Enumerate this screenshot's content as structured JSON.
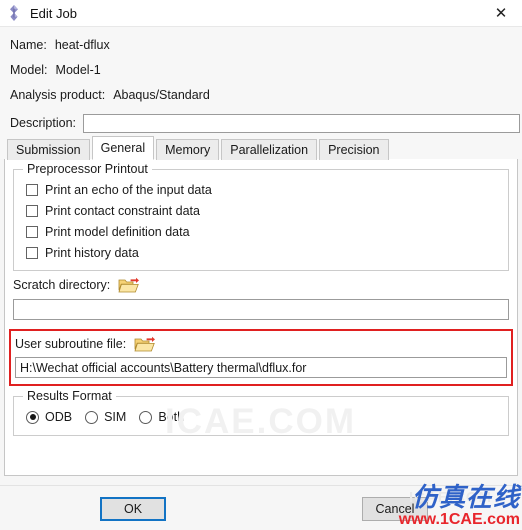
{
  "window": {
    "title": "Edit Job",
    "icon": "abaqus-diamond-icon",
    "close_label": "✕"
  },
  "header": {
    "name_label": "Name:",
    "name_value": "heat-dflux",
    "model_label": "Model:",
    "model_value": "Model-1",
    "analysis_label": "Analysis product:",
    "analysis_value": "Abaqus/Standard",
    "description_label": "Description:",
    "description_value": "",
    "description_placeholder": ""
  },
  "tabs": [
    {
      "label": "Submission",
      "active": false
    },
    {
      "label": "General",
      "active": true
    },
    {
      "label": "Memory",
      "active": false
    },
    {
      "label": "Parallelization",
      "active": false
    },
    {
      "label": "Precision",
      "active": false
    }
  ],
  "general": {
    "preprocessor_group": {
      "title": "Preprocessor Printout",
      "checkboxes": [
        {
          "label": "Print an echo of the input data",
          "checked": false
        },
        {
          "label": "Print contact constraint data",
          "checked": false
        },
        {
          "label": "Print model definition data",
          "checked": false
        },
        {
          "label": "Print history data",
          "checked": false
        }
      ]
    },
    "scratch": {
      "label": "Scratch directory:",
      "browse_icon": "open-folder-icon",
      "value": "",
      "placeholder": ""
    },
    "user_subroutine": {
      "label": "User subroutine file:",
      "browse_icon": "open-folder-icon",
      "value": "H:\\Wechat official accounts\\Battery thermal\\dflux.for",
      "placeholder": "",
      "highlight_color": "#e02020"
    },
    "results_format": {
      "title": "Results Format",
      "options": [
        {
          "label": "ODB",
          "selected": true
        },
        {
          "label": "SIM",
          "selected": false
        },
        {
          "label": "Both",
          "selected": false
        }
      ]
    }
  },
  "footer": {
    "ok_label": "OK",
    "cancel_label": "Cancel",
    "focus_color": "#1273c4"
  },
  "watermarks": {
    "center": "ICAE.COM",
    "ghost": "ICAE.COM",
    "chinese": "仿真在线",
    "url": "www.1CAE.com"
  }
}
